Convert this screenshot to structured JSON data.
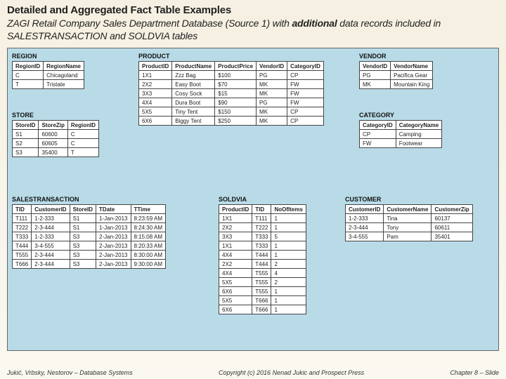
{
  "header": {
    "title": "Detailed and Aggregated Fact Table Examples",
    "subtitle_pre": "ZAGI Retail Company Sales Department Database (Source 1) with ",
    "subtitle_bold": "additional",
    "subtitle_post": " data records included in SALESTRANSACTION and SOLDVIA tables"
  },
  "tables": {
    "region": {
      "name": "REGION",
      "cols": [
        "RegionID",
        "RegionName"
      ],
      "rows": [
        [
          "C",
          "Chicagoland"
        ],
        [
          "T",
          "Tristate"
        ]
      ]
    },
    "store": {
      "name": "STORE",
      "cols": [
        "StoreID",
        "StoreZip",
        "RegionID"
      ],
      "rows": [
        [
          "S1",
          "60600",
          "C"
        ],
        [
          "S2",
          "60605",
          "C"
        ],
        [
          "S3",
          "35400",
          "T"
        ]
      ]
    },
    "product": {
      "name": "PRODUCT",
      "cols": [
        "ProductID",
        "ProductName",
        "ProductPrice",
        "VendorID",
        "CategoryID"
      ],
      "rows": [
        [
          "1X1",
          "Zzz Bag",
          "$100",
          "PG",
          "CP"
        ],
        [
          "2X2",
          "Easy Boot",
          "$70",
          "MK",
          "FW"
        ],
        [
          "3X3",
          "Cosy Sock",
          "$15",
          "MK",
          "FW"
        ],
        [
          "4X4",
          "Dura Boot",
          "$90",
          "PG",
          "FW"
        ],
        [
          "5X5",
          "Tiny Tent",
          "$150",
          "MK",
          "CP"
        ],
        [
          "6X6",
          "Biggy Tent",
          "$250",
          "MK",
          "CP"
        ]
      ]
    },
    "vendor": {
      "name": "VENDOR",
      "cols": [
        "VendorID",
        "VendorName"
      ],
      "rows": [
        [
          "PG",
          "Pacifica Gear"
        ],
        [
          "MK",
          "Mountain King"
        ]
      ]
    },
    "category": {
      "name": "CATEGORY",
      "cols": [
        "CategoryID",
        "CategoryName"
      ],
      "rows": [
        [
          "CP",
          "Camping"
        ],
        [
          "FW",
          "Footwear"
        ]
      ]
    },
    "salestransaction": {
      "name": "SALESTRANSACTION",
      "cols": [
        "TID",
        "CustomerID",
        "StoreID",
        "TDate",
        "TTime"
      ],
      "rows": [
        [
          "T111",
          "1-2-333",
          "S1",
          "1-Jan-2013",
          "8:23:59 AM"
        ],
        [
          "T222",
          "2-3-444",
          "S1",
          "1-Jan-2013",
          "8:24:30 AM"
        ],
        [
          "T333",
          "1-2-333",
          "S3",
          "2-Jan-2013",
          "8:15:08 AM"
        ],
        [
          "T444",
          "3-4-555",
          "S3",
          "2-Jan-2013",
          "8:20:33 AM"
        ],
        [
          "T555",
          "2-3-444",
          "S3",
          "2-Jan-2013",
          "8:30:00 AM"
        ],
        [
          "T666",
          "2-3-444",
          "S3",
          "2-Jan-2013",
          "9:30:00 AM"
        ]
      ]
    },
    "soldvia": {
      "name": "SOLDVIA",
      "cols": [
        "ProductID",
        "TID",
        "NoOfItems"
      ],
      "rows": [
        [
          "1X1",
          "T111",
          "1"
        ],
        [
          "2X2",
          "T222",
          "1"
        ],
        [
          "3X3",
          "T333",
          "5"
        ],
        [
          "1X1",
          "T333",
          "1"
        ],
        [
          "4X4",
          "T444",
          "1"
        ],
        [
          "2X2",
          "T444",
          "2"
        ],
        [
          "4X4",
          "T555",
          "4"
        ],
        [
          "5X5",
          "T555",
          "2"
        ],
        [
          "6X6",
          "T555",
          "1"
        ],
        [
          "5X5",
          "T666",
          "1"
        ],
        [
          "6X6",
          "T666",
          "1"
        ]
      ]
    },
    "customer": {
      "name": "CUSTOMER",
      "cols": [
        "CustomerID",
        "CustomerName",
        "CustomerZip"
      ],
      "rows": [
        [
          "1-2-333",
          "Tina",
          "60137"
        ],
        [
          "2-3-444",
          "Tony",
          "60611"
        ],
        [
          "3-4-555",
          "Pam",
          "35401"
        ]
      ]
    }
  },
  "footer": {
    "left": "Jukić, Vrbsky, Nestorov – Database Systems",
    "center": "Copyright (c) 2016 Nenad Jukic and Prospect Press",
    "right": "Chapter 8 – Slide"
  }
}
